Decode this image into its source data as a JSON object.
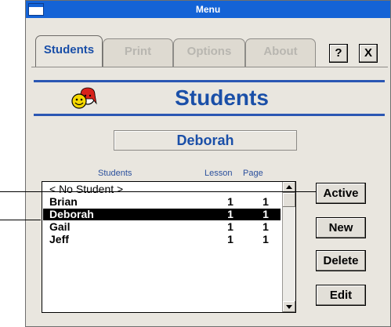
{
  "window": {
    "title": "Menu",
    "title_icon": "window-menu-icon"
  },
  "tabs": [
    {
      "label": "Students",
      "active": true
    },
    {
      "label": "Print",
      "active": false
    },
    {
      "label": "Options",
      "active": false
    },
    {
      "label": "About",
      "active": false
    }
  ],
  "buttons": {
    "help": "?",
    "close": "X"
  },
  "header": {
    "title": "Students",
    "icon": "students-smiley-icon"
  },
  "selected_student": "Deborah",
  "list": {
    "columns": {
      "name": "Students",
      "lesson": "Lesson",
      "page": "Page"
    },
    "rows": [
      {
        "name": "< No Student >",
        "lesson": "",
        "page": ""
      },
      {
        "name": "Brian",
        "lesson": "1",
        "page": "1"
      },
      {
        "name": "Deborah",
        "lesson": "1",
        "page": "1",
        "selected": true
      },
      {
        "name": "Gail",
        "lesson": "1",
        "page": "1"
      },
      {
        "name": "Jeff",
        "lesson": "1",
        "page": "1"
      }
    ]
  },
  "actions": {
    "active": "Active",
    "new": "New",
    "delete": "Delete",
    "edit": "Edit"
  },
  "colors": {
    "titlebar": "#1463d6",
    "accent": "#1a4fa8",
    "window_bg": "#e9e6df",
    "selection": "#000000"
  }
}
